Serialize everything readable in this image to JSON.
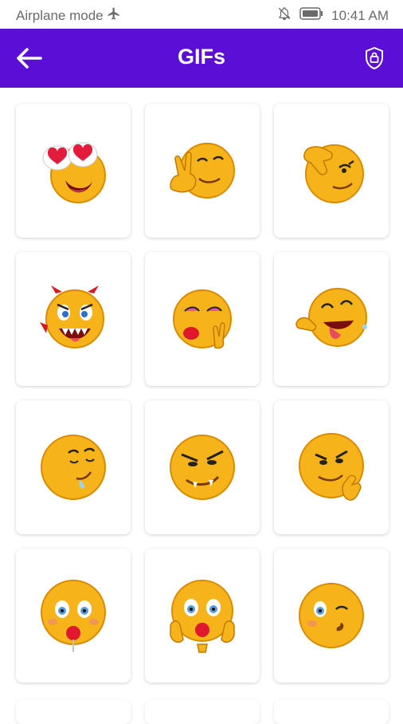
{
  "status_bar": {
    "left_text": "Airplane mode",
    "time": "10:41 AM",
    "icons": [
      "airplane-icon",
      "notification-off-icon",
      "battery-icon"
    ]
  },
  "app_bar": {
    "title": "GIFs",
    "back_icon": "arrow-left-icon",
    "action_icon": "lock-shield-icon",
    "color": "#5b0fd6"
  },
  "gifs": [
    {
      "name": "heart-eyes-emoji"
    },
    {
      "name": "peace-sign-emoji"
    },
    {
      "name": "thumbs-down-emoji"
    },
    {
      "name": "devil-emoji"
    },
    {
      "name": "rock-on-kiss-emoji"
    },
    {
      "name": "laughing-tongue-emoji"
    },
    {
      "name": "drooling-emoji"
    },
    {
      "name": "vampire-emoji"
    },
    {
      "name": "smirk-thinking-emoji"
    },
    {
      "name": "lollipop-emoji"
    },
    {
      "name": "lollipop-hands-emoji"
    },
    {
      "name": "wink-kiss-emoji"
    }
  ]
}
